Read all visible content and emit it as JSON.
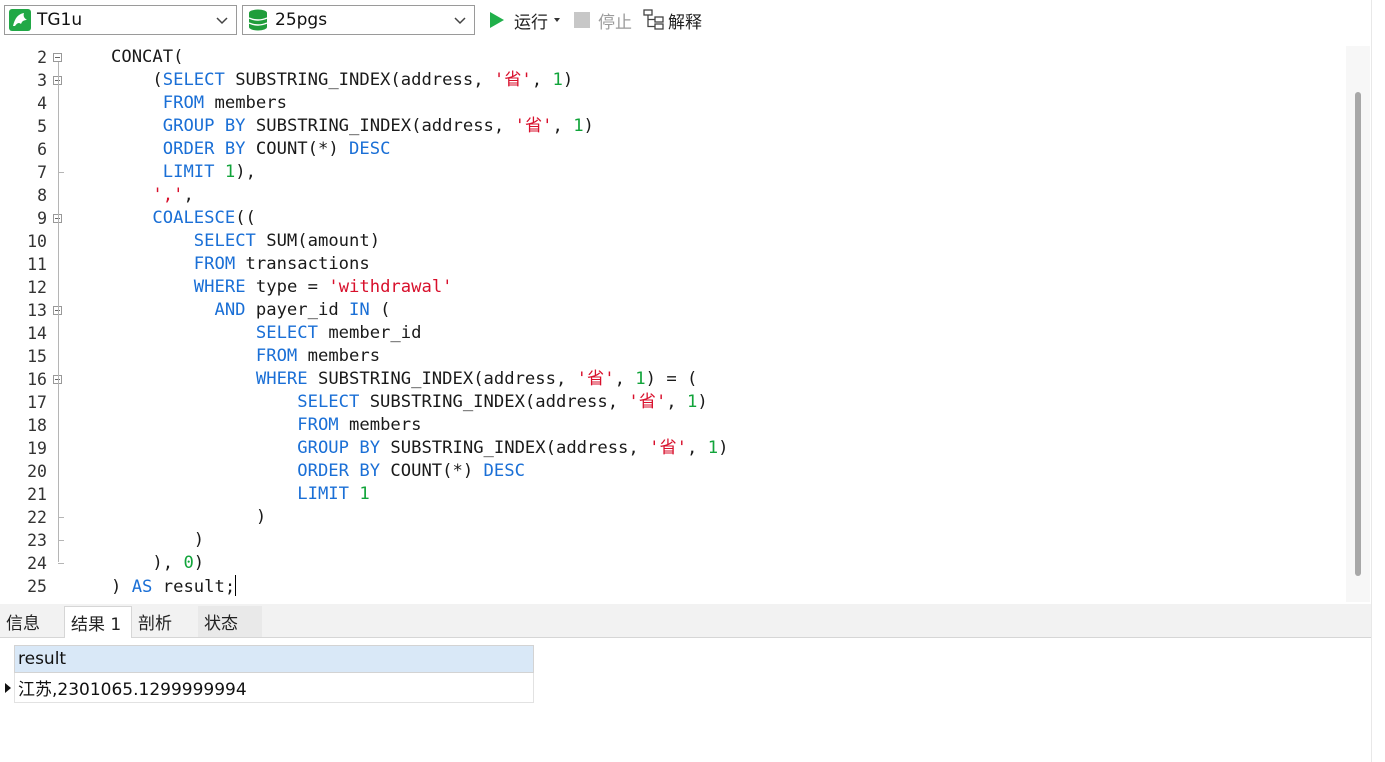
{
  "toolbar": {
    "connection": {
      "value": "TG1u",
      "icon": "mysql-dolphin-icon"
    },
    "database": {
      "value": "25pgs",
      "icon": "database-icon"
    },
    "run_label": "运行",
    "stop_label": "停止",
    "explain_label": "解释"
  },
  "colors": {
    "keyword": "#1a6fd6",
    "string": "#d8102c",
    "number": "#11a43a",
    "run_green": "#21b04b",
    "db_green": "#1f9d3a",
    "grid_header": "#d9e8f7"
  },
  "editor": {
    "line_numbers": [
      "2",
      "3",
      "4",
      "5",
      "6",
      "7",
      "8",
      "9",
      "10",
      "11",
      "12",
      "13",
      "14",
      "15",
      "16",
      "17",
      "18",
      "19",
      "20",
      "21",
      "22",
      "23",
      "24",
      "25"
    ],
    "lines": [
      [
        [
          "p",
          "CONCAT("
        ]
      ],
      [
        [
          "p",
          "    ("
        ],
        [
          "k",
          "SELECT"
        ],
        [
          "p",
          " SUBSTRING_INDEX(address, "
        ],
        [
          "s",
          "'省'"
        ],
        [
          "p",
          ", "
        ],
        [
          "n",
          "1"
        ],
        [
          "p",
          ")"
        ]
      ],
      [
        [
          "p",
          "     "
        ],
        [
          "k",
          "FROM"
        ],
        [
          "p",
          " members"
        ]
      ],
      [
        [
          "p",
          "     "
        ],
        [
          "k",
          "GROUP BY"
        ],
        [
          "p",
          " SUBSTRING_INDEX(address, "
        ],
        [
          "s",
          "'省'"
        ],
        [
          "p",
          ", "
        ],
        [
          "n",
          "1"
        ],
        [
          "p",
          ")"
        ]
      ],
      [
        [
          "p",
          "     "
        ],
        [
          "k",
          "ORDER BY"
        ],
        [
          "p",
          " COUNT(*) "
        ],
        [
          "k",
          "DESC"
        ]
      ],
      [
        [
          "p",
          "     "
        ],
        [
          "k",
          "LIMIT"
        ],
        [
          "p",
          " "
        ],
        [
          "n",
          "1"
        ],
        [
          "p",
          "),"
        ]
      ],
      [
        [
          "p",
          "    "
        ],
        [
          "s",
          "','"
        ],
        [
          "p",
          ","
        ]
      ],
      [
        [
          "p",
          "    "
        ],
        [
          "k",
          "COALESCE"
        ],
        [
          "p",
          "(("
        ]
      ],
      [
        [
          "p",
          "        "
        ],
        [
          "k",
          "SELECT"
        ],
        [
          "p",
          " SUM(amount)"
        ]
      ],
      [
        [
          "p",
          "        "
        ],
        [
          "k",
          "FROM"
        ],
        [
          "p",
          " transactions"
        ]
      ],
      [
        [
          "p",
          "        "
        ],
        [
          "k",
          "WHERE"
        ],
        [
          "p",
          " type = "
        ],
        [
          "s",
          "'withdrawal'"
        ]
      ],
      [
        [
          "p",
          "          "
        ],
        [
          "k",
          "AND"
        ],
        [
          "p",
          " payer_id "
        ],
        [
          "k",
          "IN"
        ],
        [
          "p",
          " ("
        ]
      ],
      [
        [
          "p",
          "              "
        ],
        [
          "k",
          "SELECT"
        ],
        [
          "p",
          " member_id"
        ]
      ],
      [
        [
          "p",
          "              "
        ],
        [
          "k",
          "FROM"
        ],
        [
          "p",
          " members"
        ]
      ],
      [
        [
          "p",
          "              "
        ],
        [
          "k",
          "WHERE"
        ],
        [
          "p",
          " SUBSTRING_INDEX(address, "
        ],
        [
          "s",
          "'省'"
        ],
        [
          "p",
          ", "
        ],
        [
          "n",
          "1"
        ],
        [
          "p",
          ") = ("
        ]
      ],
      [
        [
          "p",
          "                  "
        ],
        [
          "k",
          "SELECT"
        ],
        [
          "p",
          " SUBSTRING_INDEX(address, "
        ],
        [
          "s",
          "'省'"
        ],
        [
          "p",
          ", "
        ],
        [
          "n",
          "1"
        ],
        [
          "p",
          ")"
        ]
      ],
      [
        [
          "p",
          "                  "
        ],
        [
          "k",
          "FROM"
        ],
        [
          "p",
          " members"
        ]
      ],
      [
        [
          "p",
          "                  "
        ],
        [
          "k",
          "GROUP BY"
        ],
        [
          "p",
          " SUBSTRING_INDEX(address, "
        ],
        [
          "s",
          "'省'"
        ],
        [
          "p",
          ", "
        ],
        [
          "n",
          "1"
        ],
        [
          "p",
          ")"
        ]
      ],
      [
        [
          "p",
          "                  "
        ],
        [
          "k",
          "ORDER BY"
        ],
        [
          "p",
          " COUNT(*) "
        ],
        [
          "k",
          "DESC"
        ]
      ],
      [
        [
          "p",
          "                  "
        ],
        [
          "k",
          "LIMIT"
        ],
        [
          "p",
          " "
        ],
        [
          "n",
          "1"
        ]
      ],
      [
        [
          "p",
          "              )"
        ]
      ],
      [
        [
          "p",
          "        )"
        ]
      ],
      [
        [
          "p",
          "    ), "
        ],
        [
          "n",
          "0"
        ],
        [
          "p",
          ")"
        ]
      ],
      [
        [
          "p",
          ") "
        ],
        [
          "k",
          "AS"
        ],
        [
          "p",
          " result;"
        ]
      ]
    ]
  },
  "tabs": [
    {
      "label": "信息",
      "active": false
    },
    {
      "label": "结果 1",
      "active": true
    },
    {
      "label": "剖析",
      "active": false
    },
    {
      "label": "状态",
      "active": false
    }
  ],
  "result": {
    "column": "result",
    "rows": [
      "江苏,2301065.1299999994"
    ]
  }
}
